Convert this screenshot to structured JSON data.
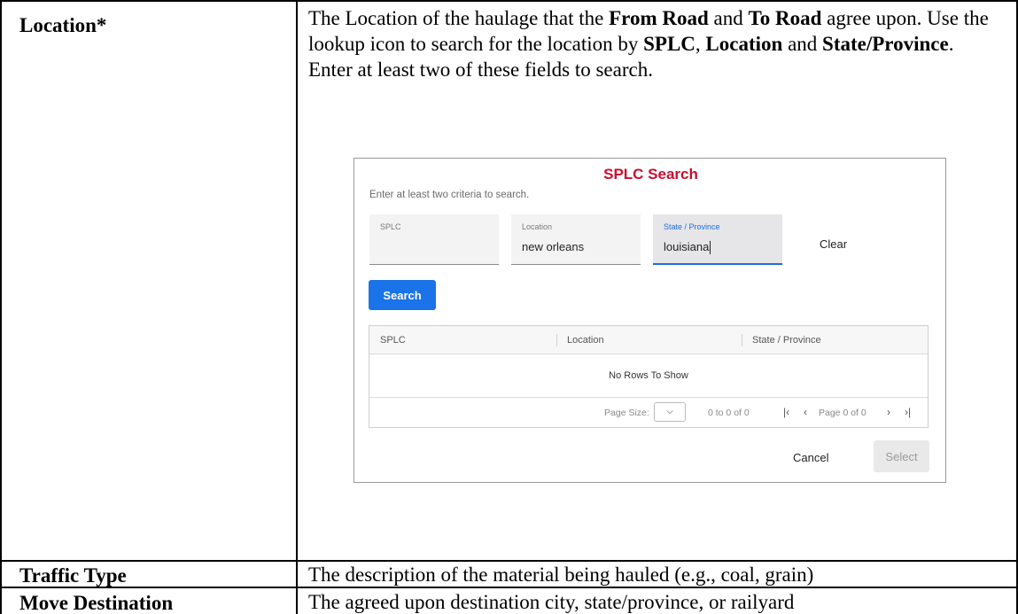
{
  "rows": [
    {
      "label": "Location*",
      "desc": {
        "p1": "The Location of the haulage that the ",
        "b1": "From Road",
        "p2": " and ",
        "b2": "To Road",
        "p3": " agree upon. Use the lookup icon to search for the location by ",
        "b3": "SPLC",
        "p4": ", ",
        "b4": "Location",
        "p5": " and ",
        "b5": "State/Province",
        "p6": ". Enter at least two of these fields to search."
      }
    },
    {
      "label": "Traffic Type",
      "desc": "The description of the material being hauled (e.g., coal, grain)"
    },
    {
      "label": "Move Destination",
      "desc": "The agreed upon destination city, state/province, or railyard"
    }
  ],
  "dialog": {
    "title": "SPLC Search",
    "hint": "Enter at least two criteria to search.",
    "fields": [
      {
        "label": "SPLC",
        "value": ""
      },
      {
        "label": "Location",
        "value": "new orleans"
      },
      {
        "label": "State / Province",
        "value": "louisiana"
      }
    ],
    "clear_label": "Clear",
    "search_label": "Search",
    "grid": {
      "columns": [
        "SPLC",
        "Location",
        "State / Province"
      ],
      "empty_text": "No Rows To Show",
      "page_size_label": "Page Size:",
      "page_size_value": "",
      "range_text": "0 to 0 of 0",
      "page_text": "Page 0 of 0"
    },
    "cancel_label": "Cancel",
    "select_label": "Select"
  },
  "colors": {
    "title": "#c8102e",
    "accent": "#1a73e8"
  }
}
